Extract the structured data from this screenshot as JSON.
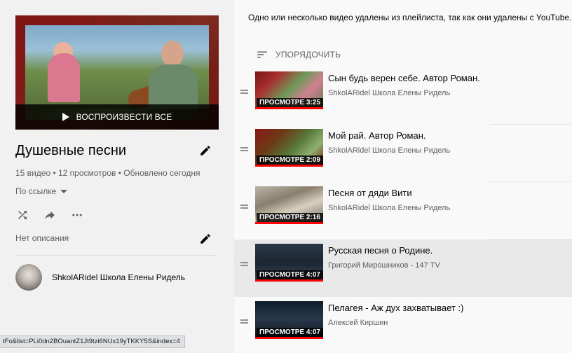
{
  "playlist": {
    "play_all_label": "ВОСПРОИЗВЕСТИ ВСЕ",
    "title": "Душевные песни",
    "meta": "15 видео • 12 просмотров • Обновлено сегодня",
    "privacy": "По ссылке",
    "description": "Нет описания",
    "owner": "ShkolARidel Школа Елены Ридель"
  },
  "notice": "Одно или несколько видео удалены из плейлиста, так как они удалены с YouTube.",
  "sort_label": "УПОРЯДОЧИТЬ",
  "status_url": "tFo&list=PLi0dn2BOuantZ1Jt9tzi6NUx19yTKKY5S&index=4",
  "videos": [
    {
      "title": "Сын будь верен себе. Автор Роман.",
      "channel": "ShkolARidel Школа Елены Ридель",
      "overlay": "ПРОСМОТРЕ 3:25",
      "progress": 1.0,
      "active": false
    },
    {
      "title": "Мой рай. Автор Роман.",
      "channel": "ShkolARidel Школа Елены Ридель",
      "overlay": "ПРОСМОТРЕ 2:09",
      "progress": 1.0,
      "active": false
    },
    {
      "title": "Песня от дяди Вити",
      "channel": "ShkolARidel Школа Елены Ридель",
      "overlay": "ПРОСМОТРЕ 2:16",
      "progress": 1.0,
      "active": false
    },
    {
      "title": "Русская песня о Родине.",
      "channel": "Григорий Мирошников - 147 TV",
      "overlay": "ПРОСМОТРЕ 4:07",
      "progress": 1.0,
      "active": true
    },
    {
      "title": "Пелагея - Аж дух захватывает :)",
      "channel": "Алексей Киршин",
      "overlay": "ПРОСМОТРЕ 4:07",
      "progress": 1.0,
      "active": false
    }
  ],
  "colors": {
    "accent": "#ff0000",
    "text_secondary": "#606060"
  }
}
